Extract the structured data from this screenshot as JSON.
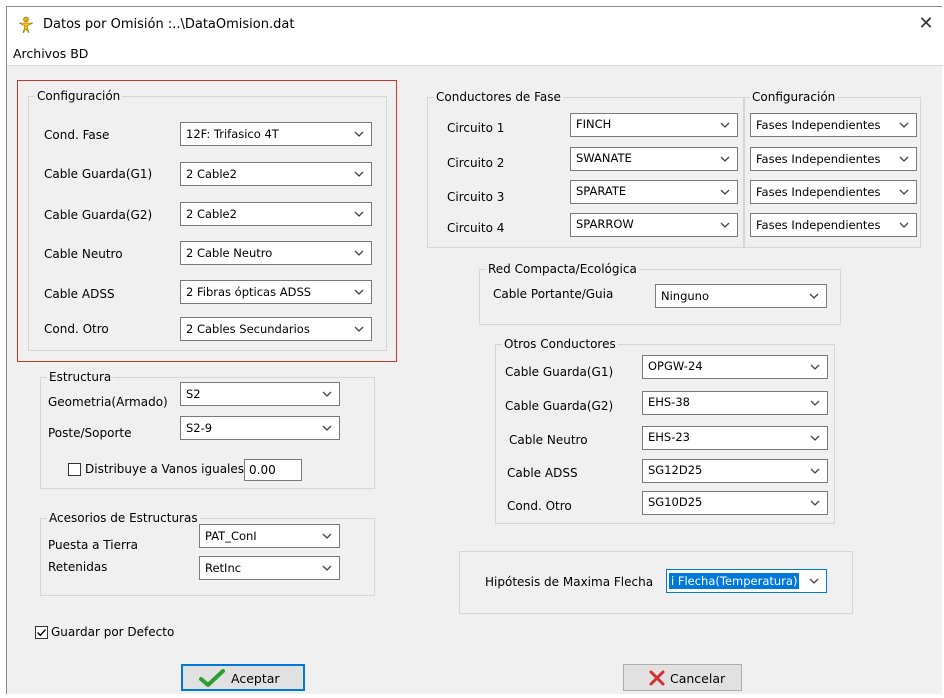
{
  "window": {
    "title": "Datos por Omisión :..\\DataOmision.dat",
    "close_glyph": "✕"
  },
  "menu": {
    "archivos": "Archivos BD"
  },
  "config": {
    "title": "Configuración",
    "rows": [
      {
        "label": "Cond. Fase",
        "value": "12F: Trifasico 4T"
      },
      {
        "label": "Cable Guarda(G1)",
        "value": "2 Cable2"
      },
      {
        "label": "Cable Guarda(G2)",
        "value": "2 Cable2"
      },
      {
        "label": "Cable Neutro",
        "value": "2 Cable Neutro"
      },
      {
        "label": "Cable ADSS",
        "value": "2 Fibras ópticas ADSS"
      },
      {
        "label": "Cond. Otro",
        "value": "2 Cables Secundarios"
      }
    ]
  },
  "estructura": {
    "title": "Estructura",
    "geometria_label": "Geometria(Armado)",
    "geometria_value": "S2",
    "poste_label": "Poste/Soporte",
    "poste_value": "S2-9",
    "distribuye_label": "Distribuye a Vanos iguales",
    "distribuye_checked": false,
    "distribuye_value": "0.00"
  },
  "accesorios": {
    "title": "Acesorios de Estructuras",
    "puesta_label": "Puesta a Tierra",
    "puesta_value": "PAT_ConI",
    "retenidas_label": "Retenidas",
    "retenidas_value": "RetInc"
  },
  "guardar": {
    "label": "Guardar por Defecto",
    "checked": true
  },
  "fase": {
    "title": "Conductores de Fase",
    "config_title": "Configuración",
    "rows": [
      {
        "label": "Circuito 1",
        "value": "FINCH",
        "config": "Fases Independientes"
      },
      {
        "label": "Circuito 2",
        "value": "SWANATE",
        "config": "Fases Independientes"
      },
      {
        "label": "Circuito 3",
        "value": "SPARATE",
        "config": "Fases Independientes"
      },
      {
        "label": "Circuito 4",
        "value": "SPARROW",
        "config": "Fases Independientes"
      }
    ]
  },
  "red": {
    "title": "Red Compacta/Ecológica",
    "label": "Cable Portante/Guia",
    "value": "Ninguno"
  },
  "otros": {
    "title": "Otros Conductores",
    "rows": [
      {
        "label": "Cable Guarda(G1)",
        "value": "OPGW-24"
      },
      {
        "label": "Cable Guarda(G2)",
        "value": "EHS-38"
      },
      {
        "label": "Cable Neutro",
        "value": "EHS-23"
      },
      {
        "label": "Cable ADSS",
        "value": "SG12D25"
      },
      {
        "label": "Cond. Otro",
        "value": "SG10D25"
      }
    ]
  },
  "hipotesis": {
    "label": "Hipótesis de Maxima Flecha",
    "value": "i Flecha(Temperatura)"
  },
  "buttons": {
    "aceptar": "Aceptar",
    "cancelar": "Cancelar"
  },
  "icons": {
    "app": "yellow-figure-icon",
    "ok": "green-checkmark-icon",
    "cancel": "red-x-icon"
  },
  "colors": {
    "highlight": "#0078d7",
    "config_border": "#c0392b",
    "ok_green": "#2e9e2e",
    "cancel_red": "#d32f2f"
  }
}
